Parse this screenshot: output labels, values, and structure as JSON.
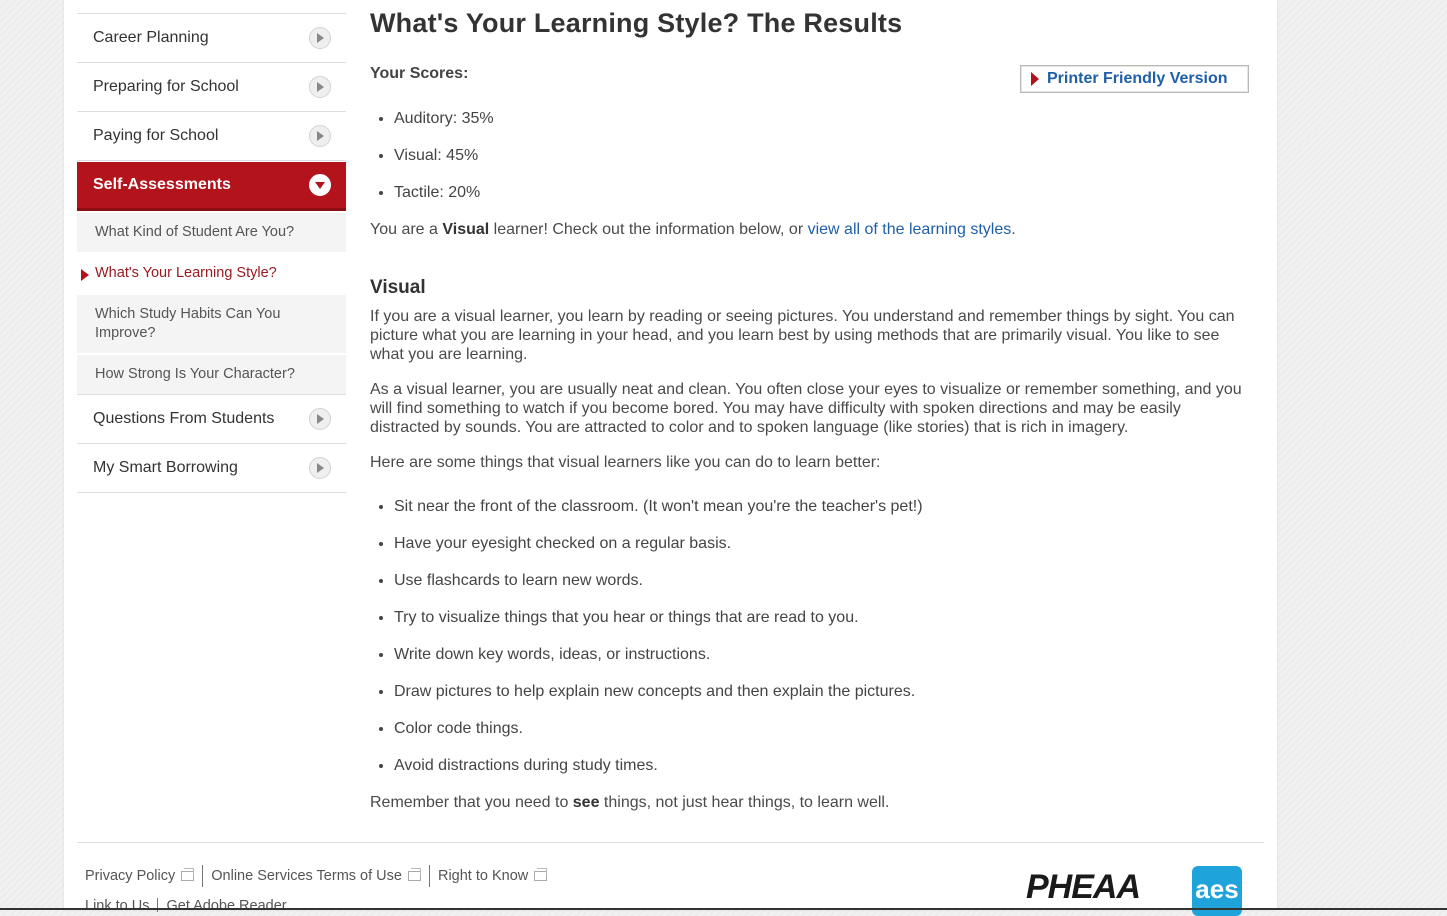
{
  "sidebar": {
    "items_top": [
      {
        "label": "Career Planning"
      },
      {
        "label": "Preparing for School"
      },
      {
        "label": "Paying for School"
      }
    ],
    "active": {
      "label": "Self-Assessments"
    },
    "sub_items": [
      {
        "label": "What Kind of Student Are You?"
      },
      {
        "label": "What's Your Learning Style?"
      },
      {
        "label": "Which Study Habits Can You Improve?"
      },
      {
        "label": "How Strong Is Your Character?"
      }
    ],
    "items_bottom": [
      {
        "label": "Questions From Students"
      },
      {
        "label": "My Smart Borrowing"
      }
    ]
  },
  "main": {
    "title": "What's Your Learning Style? The Results",
    "scores_heading": "Your Scores:",
    "printer_button": "Printer Friendly Version",
    "scores": [
      "Auditory: 35%",
      "Visual: 45%",
      "Tactile: 20%"
    ],
    "result": {
      "prefix": "You are a ",
      "style": "Visual",
      "middle": " learner! Check out the information below, or ",
      "link": "view all of the learning styles",
      "suffix": "."
    },
    "section_title": "Visual",
    "para1": "If you are a visual learner, you learn by reading or seeing pictures. You understand and remember things by sight. You can picture what you are learning in your head, and you learn best by using methods that are primarily visual. You like to see what you are learning.",
    "para2": "As a visual learner, you are usually neat and clean. You often close your eyes to visualize or remember something, and you will find something to watch if you become bored. You may have difficulty with spoken directions and may be easily distracted by sounds. You are attracted to color and to spoken language (like stories) that is rich in imagery.",
    "tips_intro": "Here are some things that visual learners like you can do to learn better:",
    "tips": [
      "Sit near the front of the classroom. (It won't mean you're the teacher's pet!)",
      "Have your eyesight checked on a regular basis.",
      "Use flashcards to learn new words.",
      "Try to visualize things that you hear or things that are read to you.",
      "Write down key words, ideas, or instructions.",
      "Draw pictures to help explain new concepts and then explain the pictures.",
      "Color code things.",
      "Avoid distractions during study times."
    ],
    "closing": {
      "prefix": "Remember that you need to ",
      "bold": "see",
      "suffix": " things, not just hear things, to learn well."
    }
  },
  "footer": {
    "links": [
      "Privacy Policy",
      "Online Services Terms of Use",
      "Right to Know"
    ],
    "links2": [
      "Link to Us",
      "Get Adobe Reader"
    ],
    "logo1": "PHEAA",
    "logo2": "aes"
  }
}
